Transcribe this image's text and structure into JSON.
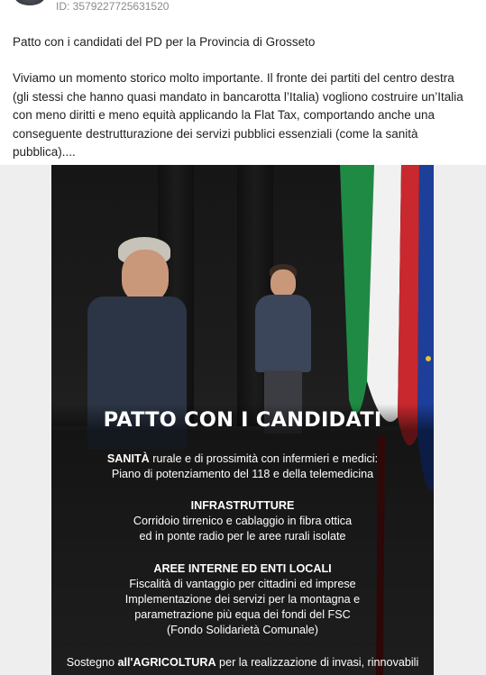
{
  "post": {
    "id_text": "ID: 3579227725631520",
    "title": "Patto con i candidati del PD per la Provincia di Grosseto",
    "body": "Viviamo un momento storico molto importante. Il fronte dei partiti del centro destra (gli stessi che hanno quasi mandato in bancarotta l’Italia) vogliono costruire un’Italia con meno diritti e meno equità applicando la Flat Tax, comportando anche una conseguente destrutturazione dei servizi pubblici essenziali (come la sanità pubblica)...."
  },
  "poster": {
    "title": "PATTO CON I CANDIDATI",
    "sanita_bold": "SANITÀ",
    "sanita_line1_rest": " rurale e di prossimità con infermieri e medici:",
    "sanita_line2": "Piano di potenziamento del 118 e della telemedicina",
    "infra_heading": "INFRASTRUTTURE",
    "infra_line1": "Corridoio tirrenico e cablaggio in fibra ottica",
    "infra_line2": "ed in ponte radio per le aree rurali isolate",
    "aree_heading": "AREE INTERNE ED ENTI LOCALI",
    "aree_line1": "Fiscalità di vantaggio per cittadini ed imprese",
    "aree_line2": "Implementazione dei servizi per la montagna e",
    "aree_line3": "parametrazione più equa dei fondi del FSC",
    "aree_line4": "(Fondo Solidarietà Comunale)",
    "agri_pre": "Sostegno ",
    "agri_bold": "all'AGRICOLTURA",
    "agri_rest": " per la realizzazione di invasi, rinnovabili"
  },
  "colors": {
    "flag_green": "#1f8a44",
    "flag_white": "#f1f1f1",
    "flag_red": "#c8282e",
    "eu_blue": "#1d3f9a"
  },
  "icons": {
    "avatar": "avatar"
  }
}
